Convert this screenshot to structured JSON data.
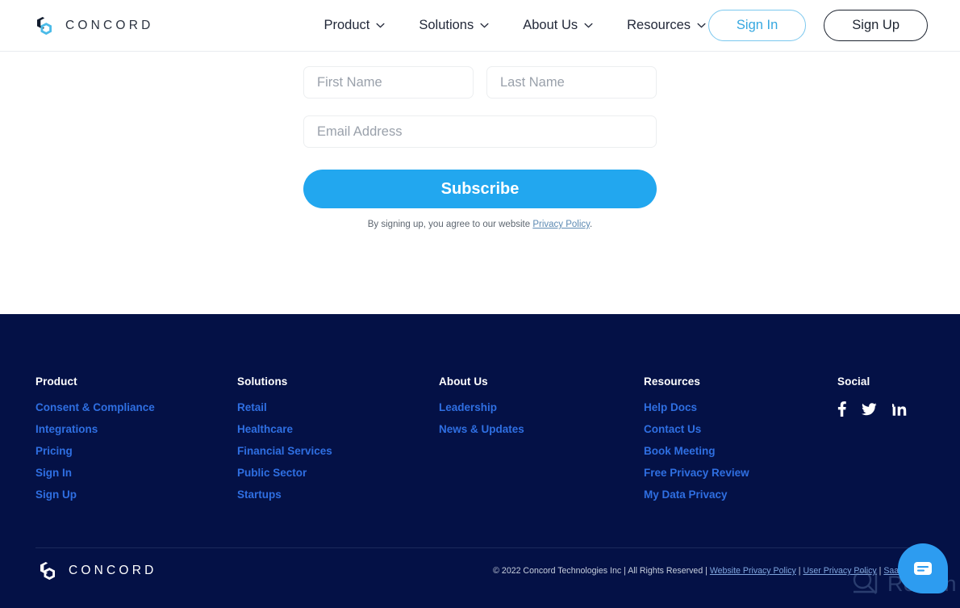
{
  "header": {
    "logo_text": "CONCORD",
    "logo_icon": "concord-hexagon-logo",
    "nav": [
      {
        "label": "Product",
        "icon": "chevron-down-icon"
      },
      {
        "label": "Solutions",
        "icon": "chevron-down-icon"
      },
      {
        "label": "About Us",
        "icon": "chevron-down-icon"
      },
      {
        "label": "Resources",
        "icon": "chevron-down-icon"
      }
    ],
    "sign_in": "Sign In",
    "sign_up": "Sign Up",
    "sign_in_color": "#35a7e0",
    "sign_up_color": "#1d2430"
  },
  "subscribe_form": {
    "first_name_placeholder": "First Name",
    "last_name_placeholder": "Last Name",
    "email_placeholder": "Email Address",
    "first_name_value": "",
    "last_name_value": "",
    "email_value": "",
    "button_label": "Subscribe",
    "button_color": "#22a7ef",
    "legal_prefix": "By signing up, you agree to our website ",
    "legal_link": "Privacy Policy",
    "legal_suffix": "."
  },
  "footer": {
    "background": "#041146",
    "link_color": "#2f6fe2",
    "columns": [
      {
        "heading": "Product",
        "links": [
          "Consent & Compliance",
          "Integrations",
          "Pricing",
          "Sign In",
          "Sign Up"
        ]
      },
      {
        "heading": "Solutions",
        "links": [
          "Retail",
          "Healthcare",
          "Financial Services",
          "Public Sector",
          "Startups"
        ]
      },
      {
        "heading": "About Us",
        "links": [
          "Leadership",
          "News & Updates"
        ]
      },
      {
        "heading": "Resources",
        "links": [
          "Help Docs",
          "Contact Us",
          "Book Meeting",
          "Free Privacy Review",
          "My Data Privacy"
        ]
      }
    ],
    "social": {
      "heading": "Social",
      "icons": [
        "facebook-icon",
        "twitter-icon",
        "linkedin-icon"
      ]
    },
    "logo_text": "CONCORD",
    "copyright": {
      "text": "© 2022 Concord Technologies Inc | All Rights Reserved | ",
      "link1": "Website Privacy Policy",
      "sep1": " | ",
      "link2": "User Privacy Policy",
      "sep2": " | ",
      "link3": "SaaS Agre"
    }
  },
  "watermark": {
    "text": "Revain",
    "icon": "revain-magnifier-logo"
  },
  "chat_widget": {
    "icon": "chat-message-icon",
    "color": "#2d9cf0"
  }
}
